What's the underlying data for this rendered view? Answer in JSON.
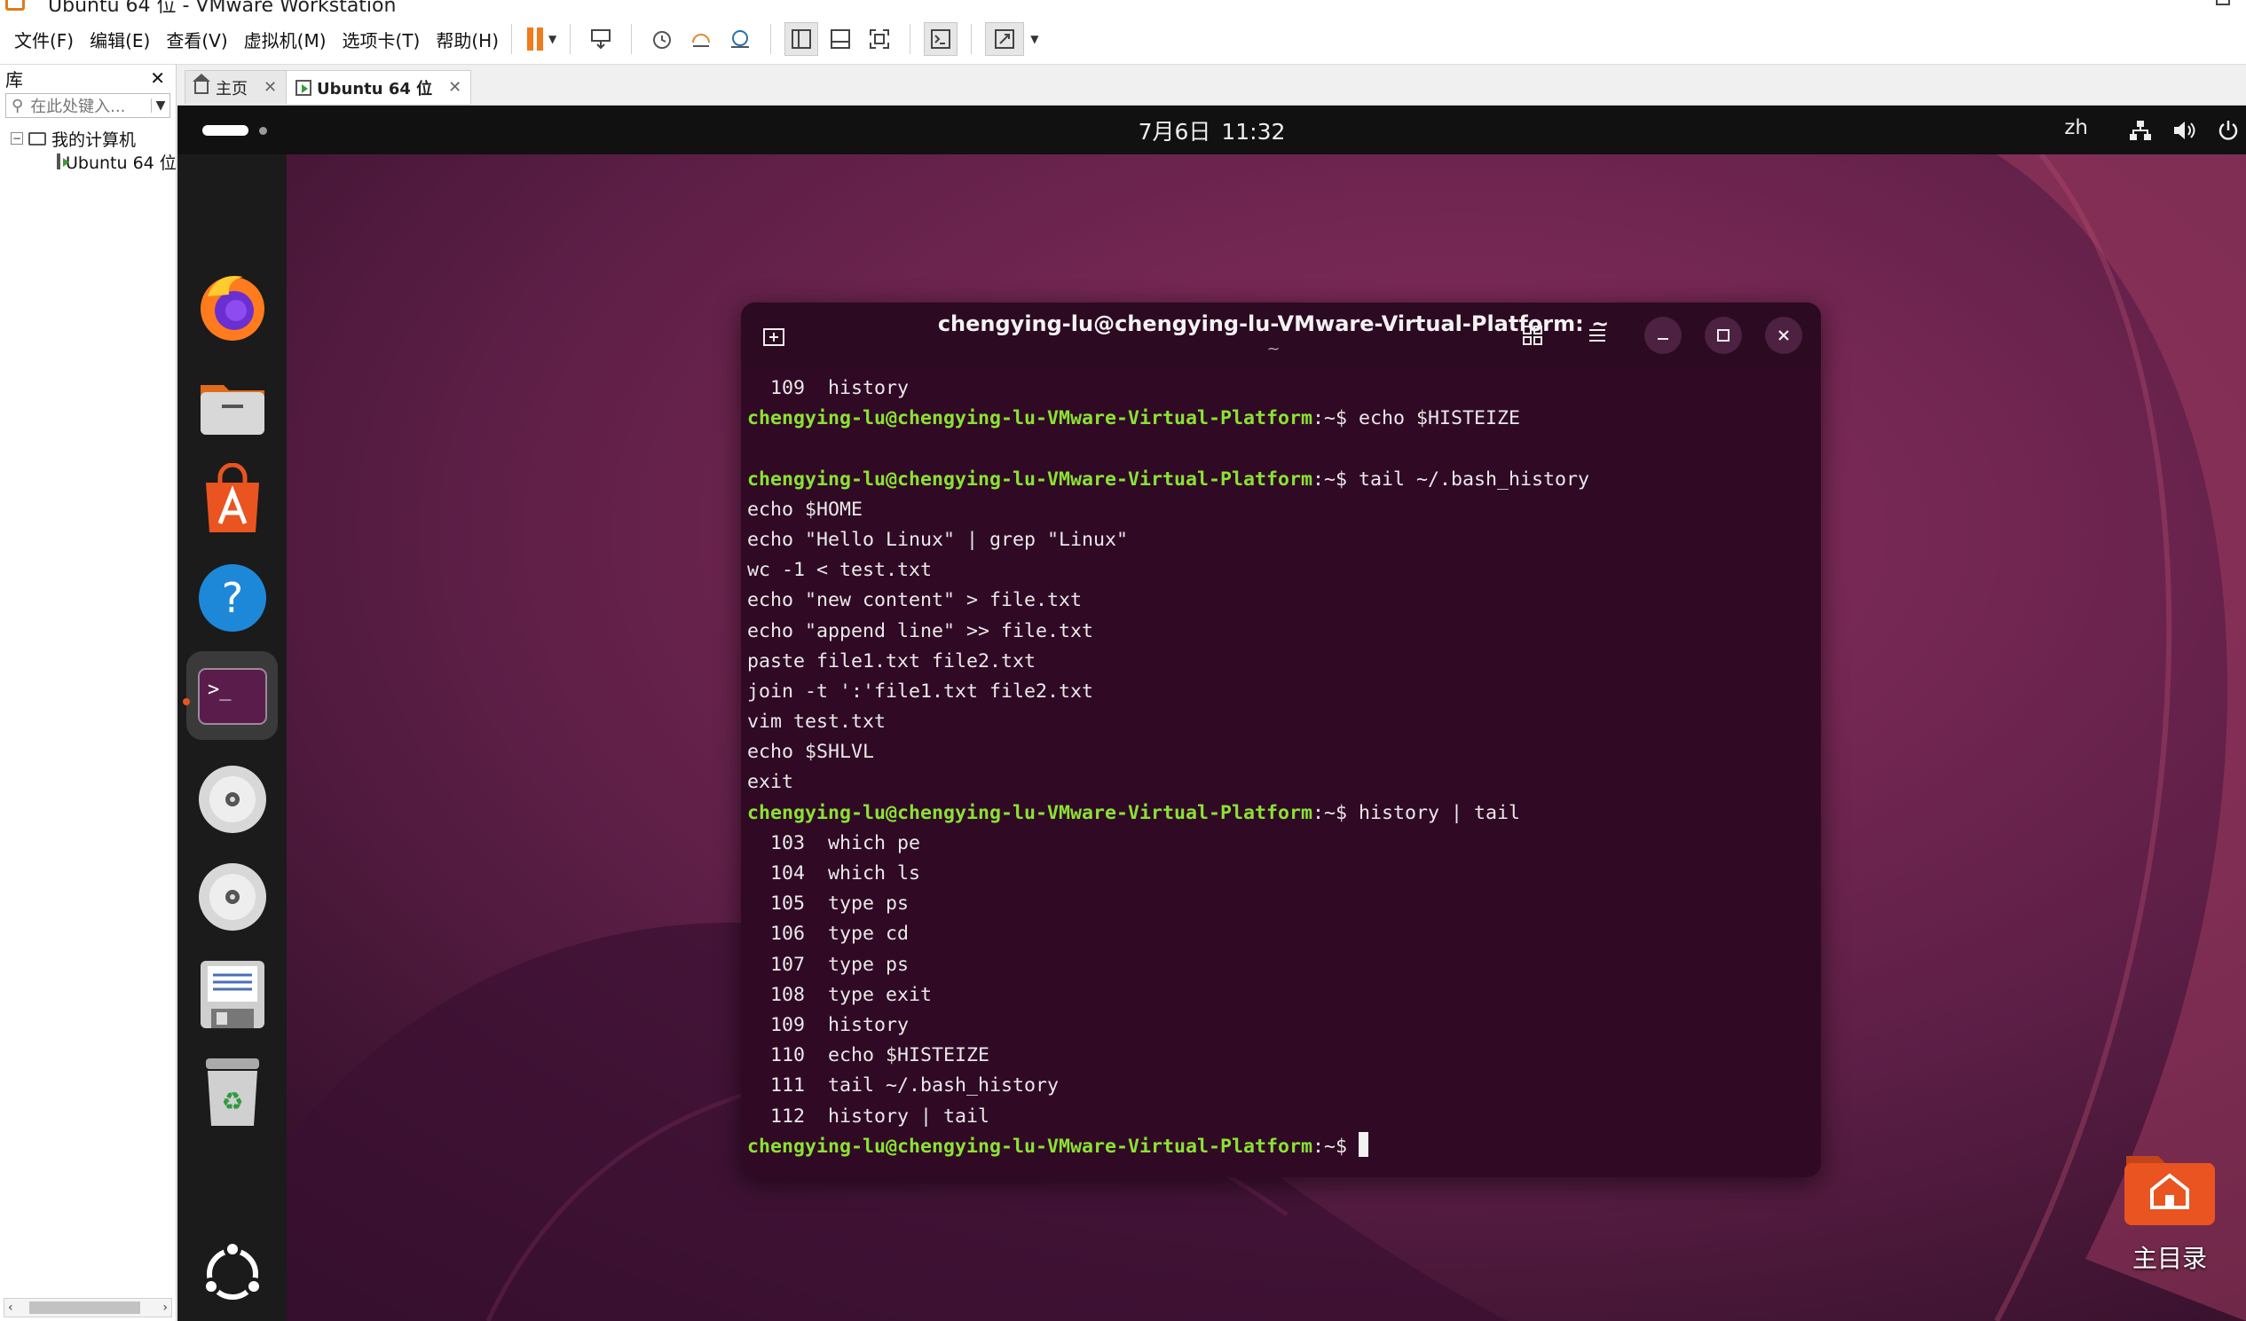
{
  "window": {
    "title": "Ubuntu 64 位 - VMware Workstation"
  },
  "menu": [
    "文件(F)",
    "编辑(E)",
    "查看(V)",
    "虚拟机(M)",
    "选项卡(T)",
    "帮助(H)"
  ],
  "toolbar": {
    "icons": [
      "pause-icon",
      "send-keys-icon",
      "snapshot-icon",
      "revert-snapshot-icon",
      "snapshot-manager-icon",
      "library-view-icon",
      "thumbnail-view-icon",
      "fullscreen-icon",
      "console-icon",
      "stretch-icon"
    ]
  },
  "library": {
    "title": "库",
    "search_placeholder": "在此处键入...",
    "tree": {
      "root": "我的计算机",
      "child": "Ubuntu 64 位"
    }
  },
  "tabs": [
    {
      "label": "主页",
      "active": false
    },
    {
      "label": "Ubuntu 64 位",
      "active": true
    }
  ],
  "ubuntu": {
    "clock": {
      "date": "7月6日",
      "time": "11:32"
    },
    "input_lang": "zh",
    "dock": [
      "firefox",
      "files",
      "app-center",
      "help",
      "terminal",
      "disc",
      "disc",
      "floppy",
      "trash",
      "show-apps"
    ],
    "desktop_home": "主目录",
    "colors": {
      "accent": "#E95420",
      "terminal_bg": "#300A24",
      "prompt": "#8AE234"
    }
  },
  "terminal": {
    "title": "chengying-lu@chengying-lu-VMware-Virtual-Platform: ~",
    "subtitle": "~",
    "prompt_user": "chengying-lu@chengying-lu-VMware-Virtual-Platform",
    "prompt_path": ":~$ ",
    "lines": [
      {
        "kind": "out",
        "text": "  109  history"
      },
      {
        "kind": "cmd",
        "text": "echo $HISTEIZE"
      },
      {
        "kind": "out",
        "text": ""
      },
      {
        "kind": "cmd",
        "text": "tail ~/.bash_history"
      },
      {
        "kind": "out",
        "text": "echo $HOME"
      },
      {
        "kind": "out",
        "text": "echo \"Hello Linux\" | grep \"Linux\""
      },
      {
        "kind": "out",
        "text": "wc -1 < test.txt"
      },
      {
        "kind": "out",
        "text": "echo \"new content\" > file.txt"
      },
      {
        "kind": "out",
        "text": "echo \"append line\" >> file.txt"
      },
      {
        "kind": "out",
        "text": "paste file1.txt file2.txt"
      },
      {
        "kind": "out",
        "text": "join -t ':'file1.txt file2.txt"
      },
      {
        "kind": "out",
        "text": "vim test.txt"
      },
      {
        "kind": "out",
        "text": "echo $SHLVL"
      },
      {
        "kind": "out",
        "text": "exit"
      },
      {
        "kind": "cmd",
        "text": "history | tail"
      },
      {
        "kind": "out",
        "text": "  103  which pe"
      },
      {
        "kind": "out",
        "text": "  104  which ls"
      },
      {
        "kind": "out",
        "text": "  105  type ps"
      },
      {
        "kind": "out",
        "text": "  106  type cd"
      },
      {
        "kind": "out",
        "text": "  107  type ps"
      },
      {
        "kind": "out",
        "text": "  108  type exit"
      },
      {
        "kind": "out",
        "text": "  109  history"
      },
      {
        "kind": "out",
        "text": "  110  echo $HISTEIZE"
      },
      {
        "kind": "out",
        "text": "  111  tail ~/.bash_history"
      },
      {
        "kind": "out",
        "text": "  112  history | tail"
      },
      {
        "kind": "prompt",
        "text": ""
      }
    ]
  }
}
